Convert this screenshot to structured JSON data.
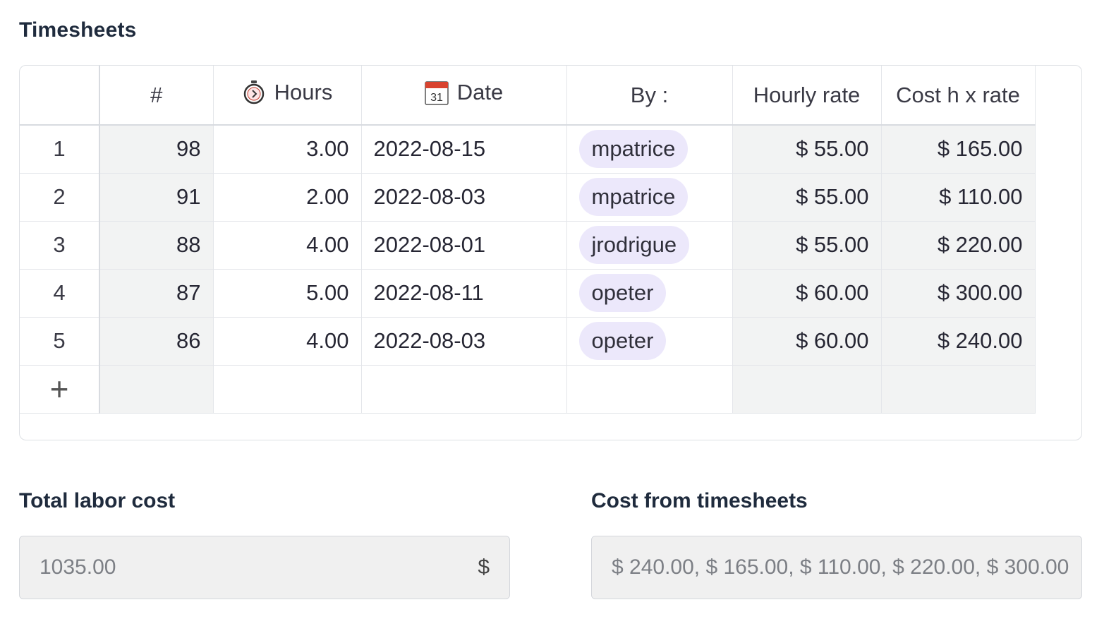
{
  "timesheets": {
    "title": "Timesheets",
    "columns": {
      "num": "#",
      "hours": "Hours",
      "hours_icon": "stopwatch-icon",
      "date": "Date",
      "date_icon": "calendar-icon",
      "date_icon_text": "31",
      "by": "By :",
      "rate": "Hourly rate",
      "cost": "Cost h x rate"
    },
    "rows": [
      {
        "row": "1",
        "num": "98",
        "hours": "3.00",
        "date": "2022-08-15",
        "by": "mpatrice",
        "rate": "$ 55.00",
        "cost": "$ 165.00"
      },
      {
        "row": "2",
        "num": "91",
        "hours": "2.00",
        "date": "2022-08-03",
        "by": "mpatrice",
        "rate": "$ 55.00",
        "cost": "$ 110.00"
      },
      {
        "row": "3",
        "num": "88",
        "hours": "4.00",
        "date": "2022-08-01",
        "by": "jrodrigue",
        "rate": "$ 55.00",
        "cost": "$ 220.00"
      },
      {
        "row": "4",
        "num": "87",
        "hours": "5.00",
        "date": "2022-08-11",
        "by": "opeter",
        "rate": "$ 60.00",
        "cost": "$ 300.00"
      },
      {
        "row": "5",
        "num": "86",
        "hours": "4.00",
        "date": "2022-08-03",
        "by": "opeter",
        "rate": "$ 60.00",
        "cost": "$ 240.00"
      }
    ],
    "add_row_symbol": "+"
  },
  "total_labor_cost": {
    "label": "Total labor cost",
    "value": "1035.00",
    "suffix": "$"
  },
  "cost_from_timesheets": {
    "label": "Cost from timesheets",
    "value": "$ 240.00, $ 165.00, $ 110.00, $ 220.00, $ 300.00"
  },
  "colors": {
    "chip_bg": "#ece8fb",
    "shaded_cell": "#f2f3f3",
    "field_bg": "#f0f0f0",
    "calendar_red": "#d9432f"
  }
}
